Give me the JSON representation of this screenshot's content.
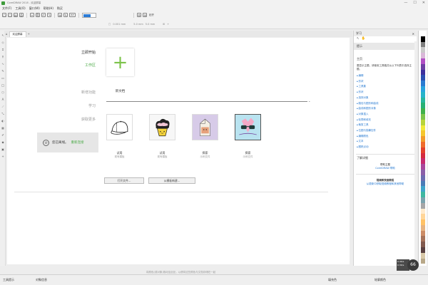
{
  "window": {
    "title": "CorelDRAW 2018 - 欢迎屏幕",
    "controls": [
      "—",
      "☐",
      "✕"
    ]
  },
  "menu": [
    "文件(F)",
    "工具(O)",
    "窗口(W)",
    "帮助(H)",
    "购买"
  ],
  "toolbar": {
    "snap_label": "贴齐",
    "icons": [
      "□",
      "▢",
      "▤",
      "⎙",
      "✂",
      "⎘",
      "↶",
      "↷",
      "⊕",
      "✎",
      "PDF"
    ]
  },
  "propbar": {
    "fields": [
      "□",
      "0.001 mm",
      "5.0 mm",
      "5.0 mm",
      "⊞",
      "+"
    ]
  },
  "doc_tab": {
    "label": "欢迎屏幕",
    "add": "+"
  },
  "left_panel": {
    "items": {
      "get_started": "立即开始",
      "workspace": "工作区",
      "whats_new": "新增功能",
      "learn": "学习",
      "get_more": "获取更多"
    },
    "offline": {
      "text": "您已离线。",
      "link": "重新连接"
    }
  },
  "new_document": {
    "label": "新文档",
    "icon": "plus-icon"
  },
  "templates": [
    {
      "name": "cap",
      "title": "试用",
      "subtitle": "现有模板"
    },
    {
      "name": "cupcake",
      "title": "试用",
      "subtitle": "现有模板"
    },
    {
      "name": "milk-carton",
      "title": "探索",
      "subtitle": "示例文件"
    },
    {
      "name": "sunglasses",
      "title": "探索",
      "subtitle": "示例文件"
    }
  ],
  "buttons": {
    "open": "打开文件...",
    "from_template": "从模板新建..."
  },
  "docker": {
    "title": "学习",
    "subtitle": "提示",
    "section": "主页",
    "description": "要显示主题，请使用工具箱并从以下列表中选择主题。",
    "topics": [
      "编辑",
      "形状",
      "工具集",
      "形状",
      "选择对象",
      "路径与图形和曲线",
      "曲线和图形对象",
      "对象插入",
      "轮廓和填充",
      "裁剪工具",
      "位图与描摹控件",
      "编辑颜色",
      "文本",
      "跟踪点动"
    ],
    "learn_more": "了解详细",
    "help_title": "帮助主题",
    "help_link": "CorelDRAW 帮助",
    "discover_title": "视频和快速教程",
    "discover_sub": "从更新中获取视频教程和其他帮助"
  },
  "palette": {
    "colors": [
      "#ffffff",
      "#000000",
      "#7f7f7f",
      "#c9c9c9",
      "#d9b8d8",
      "#b14fc4",
      "#6d3fa3",
      "#3d2f9c",
      "#2a4fb0",
      "#2a7bd1",
      "#27a3dd",
      "#26b3c9",
      "#27b59c",
      "#27b074",
      "#3fb04a",
      "#7cc34a",
      "#b7d43a",
      "#f0e83a",
      "#f5c62e",
      "#f29b2c",
      "#ee6b2b",
      "#e2402c",
      "#d42a3e",
      "#c62b6d",
      "#a8479b",
      "#8b5ea8",
      "#6c6cb0",
      "#4b7bb7",
      "#3fa4c9",
      "#3fb7a1",
      "#7aa3ad",
      "#a6a6a6",
      "#ffeacc",
      "#ffd699",
      "#ffc266",
      "#e6b380",
      "#cc8c66",
      "#a6735a",
      "#80594d",
      "#594040",
      "#d8c8a8",
      "#b8a888"
    ]
  },
  "status": {
    "hint": "将颜色(或对象)拖动至此处，以便将这些颜色与文档存储在一起",
    "left": "工具提示",
    "obj": "对象信息",
    "fill": "填充色",
    "outline": "轮廓颜色"
  },
  "cpu": {
    "percent": "66",
    "line1": "0.4K/s",
    "line2": "0.3K/s"
  }
}
